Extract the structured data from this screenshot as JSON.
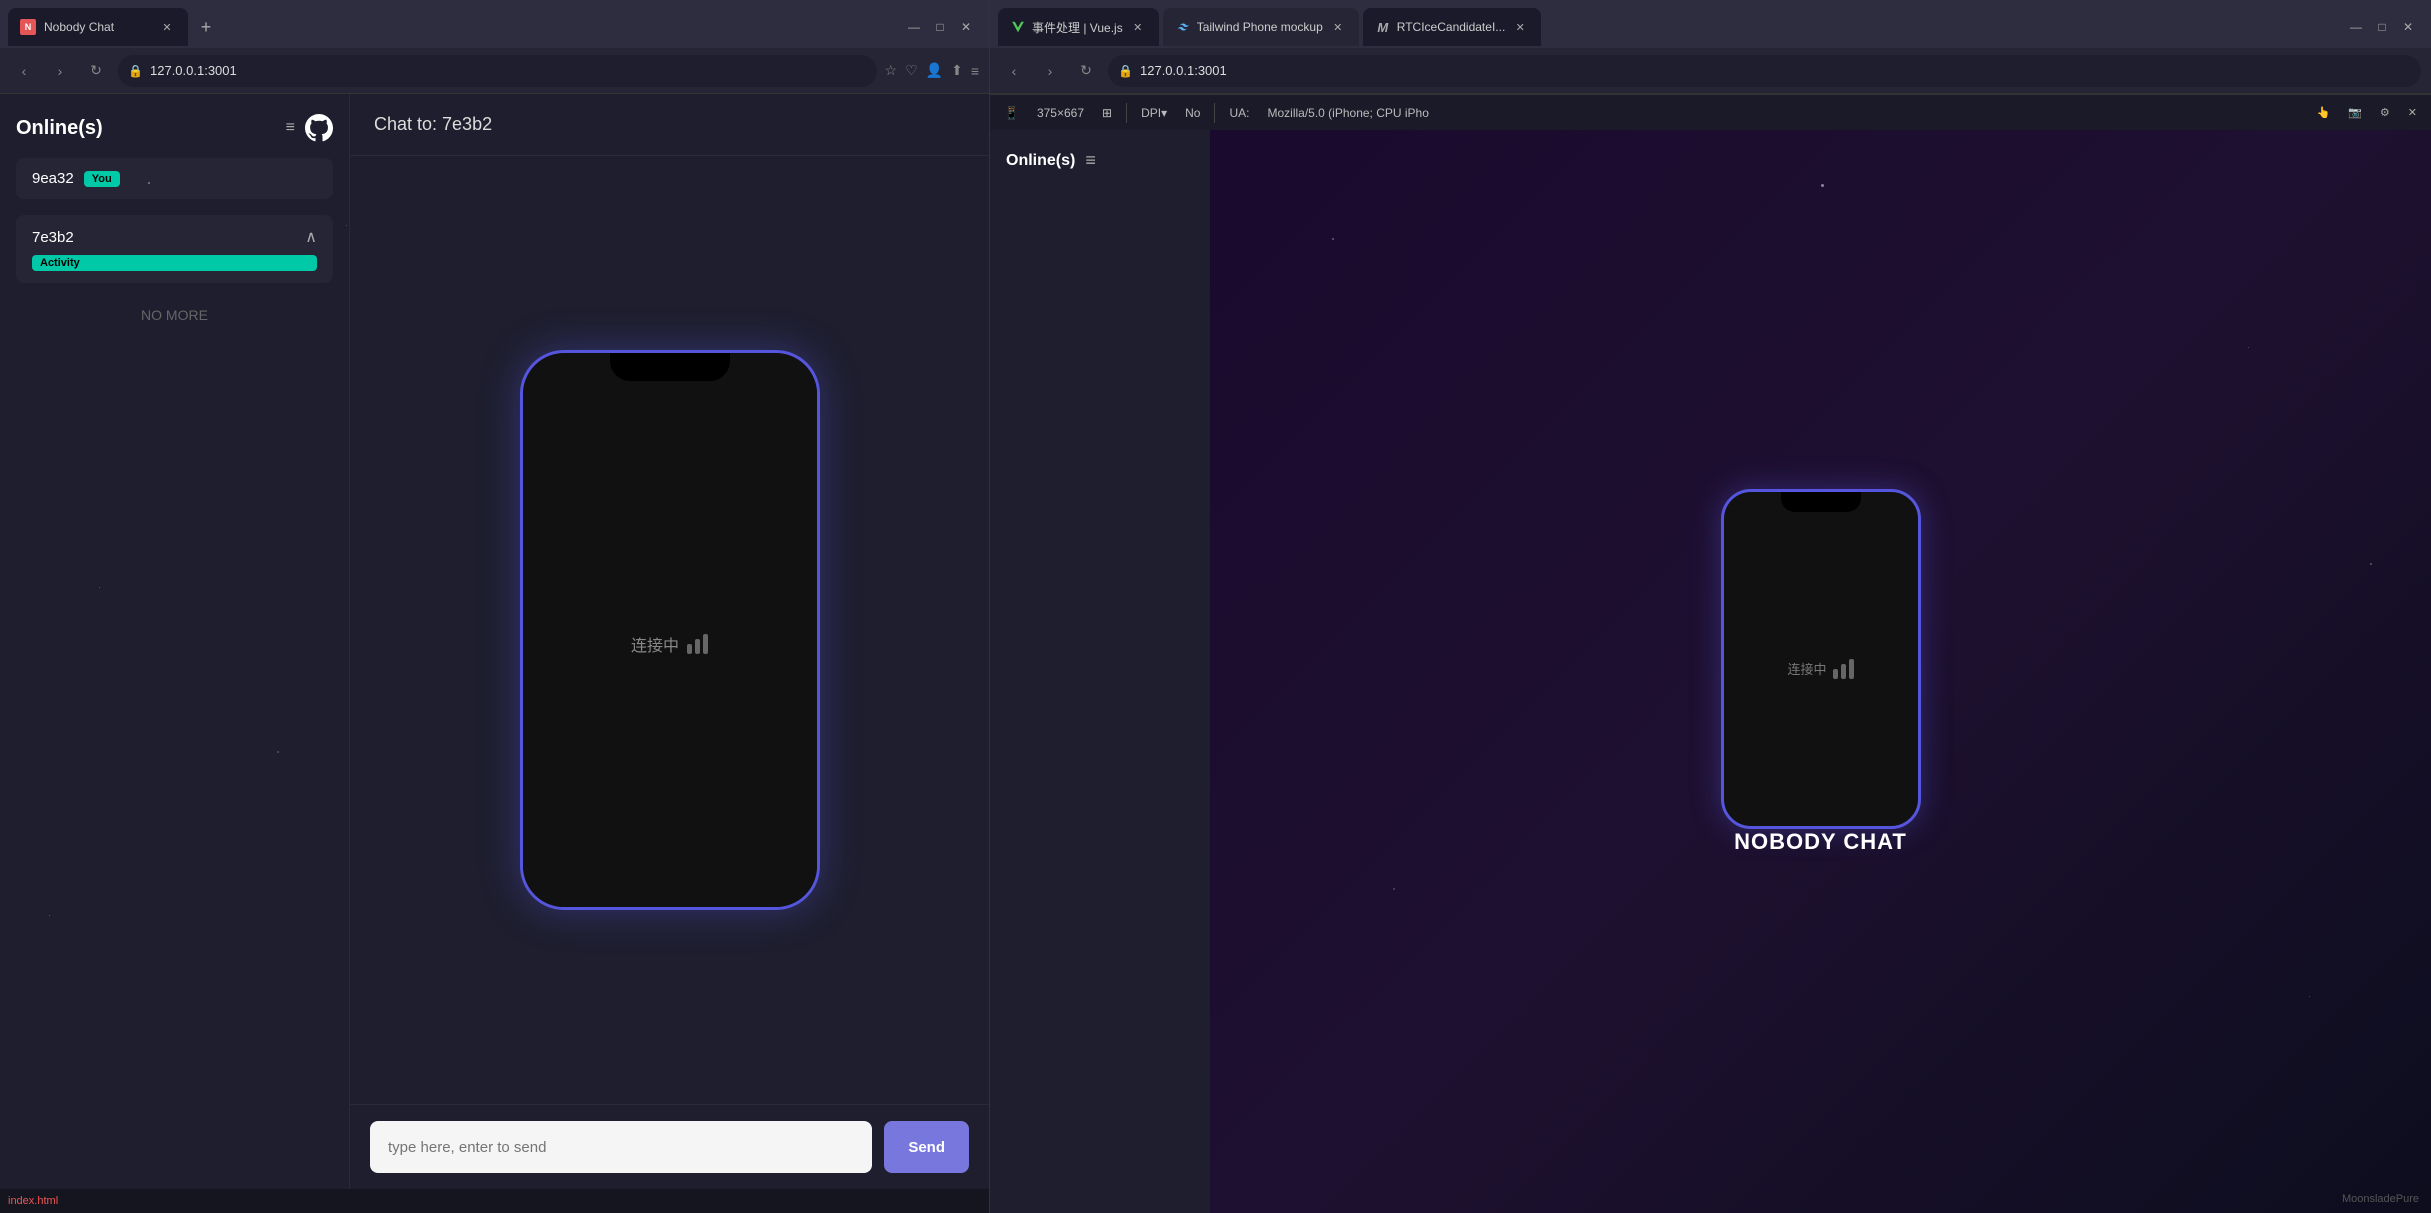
{
  "left_browser": {
    "tab": {
      "title": "Nobody Chat",
      "favicon_color": "#e55555"
    },
    "window_controls": {
      "minimize": "—",
      "maximize": "□",
      "close": "✕"
    },
    "address_bar": {
      "url": "127.0.0.1:3001",
      "back": "‹",
      "forward": "›",
      "refresh": "↻"
    },
    "sidebar": {
      "title": "Online(s)",
      "users": [
        {
          "id": "9ea32",
          "badge": "You"
        },
        {
          "id": "7e3b2",
          "activity": "Activity",
          "expanded": true
        }
      ],
      "no_more": "NO MORE"
    },
    "chat": {
      "header": "Chat to: 7e3b2",
      "connecting": "连接中",
      "input_placeholder": "type here, enter to send",
      "send_button": "Send"
    },
    "status_bar": {
      "file": "index.html"
    }
  },
  "right_browser": {
    "tabs": [
      {
        "title": "事件处理 | Vue.js",
        "favicon_type": "v",
        "active": false
      },
      {
        "title": "Tailwind Phone mockup",
        "favicon_type": "t",
        "active": true
      },
      {
        "title": "RTCIceCandidateI...",
        "favicon_type": "m",
        "active": false
      }
    ],
    "window_controls": {
      "minimize": "—",
      "maximize": "□",
      "close": "✕"
    },
    "address_bar": {
      "url": "127.0.0.1:3001"
    },
    "dev_toolbar": {
      "size": "375 × 667",
      "dpi": "DPI: No",
      "ua": "UA: Mozilla/5.0 (iPhone; CPU iPho"
    },
    "sidebar": {
      "title": "Online(s)"
    },
    "phone": {
      "connecting": "连接中",
      "label": "NOBODY CHAT"
    },
    "footer": "MoonsladePure"
  }
}
